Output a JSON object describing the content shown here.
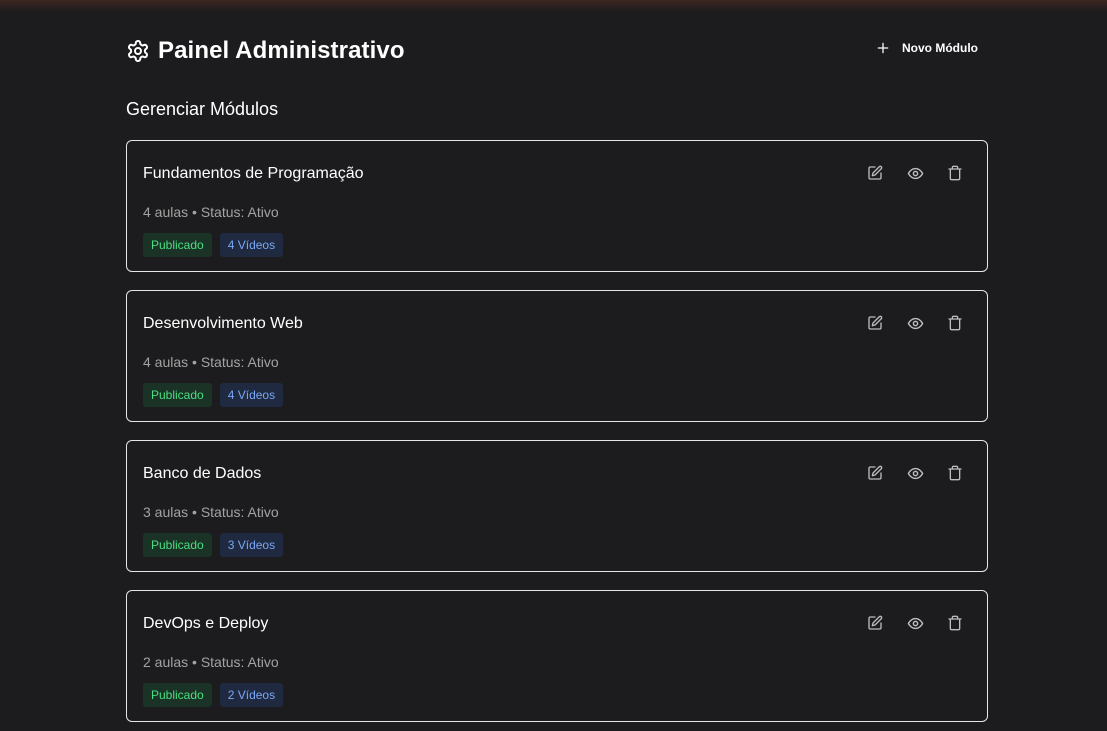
{
  "header": {
    "title": "Painel Administrativo",
    "new_module_label": "Novo Módulo"
  },
  "section_title": "Gerenciar Módulos",
  "icons": {
    "title": "gear-icon",
    "new_module": "plus-icon",
    "edit": "edit-icon",
    "view": "eye-icon",
    "delete": "trash-icon"
  },
  "colors": {
    "background": "#1c1b1d",
    "published_badge_bg": "#1b3326",
    "published_badge_text": "#4ade80",
    "videos_badge_bg": "#1f2a40",
    "videos_badge_text": "#7aa7f5"
  },
  "modules": [
    {
      "title": "Fundamentos de Programação",
      "meta": "4 aulas • Status: Ativo",
      "status_badge": "Publicado",
      "videos_badge": "4 Vídeos"
    },
    {
      "title": "Desenvolvimento Web",
      "meta": "4 aulas • Status: Ativo",
      "status_badge": "Publicado",
      "videos_badge": "4 Vídeos"
    },
    {
      "title": "Banco de Dados",
      "meta": "3 aulas • Status: Ativo",
      "status_badge": "Publicado",
      "videos_badge": "3 Vídeos"
    },
    {
      "title": "DevOps e Deploy",
      "meta": "2 aulas • Status: Ativo",
      "status_badge": "Publicado",
      "videos_badge": "2 Vídeos"
    }
  ]
}
